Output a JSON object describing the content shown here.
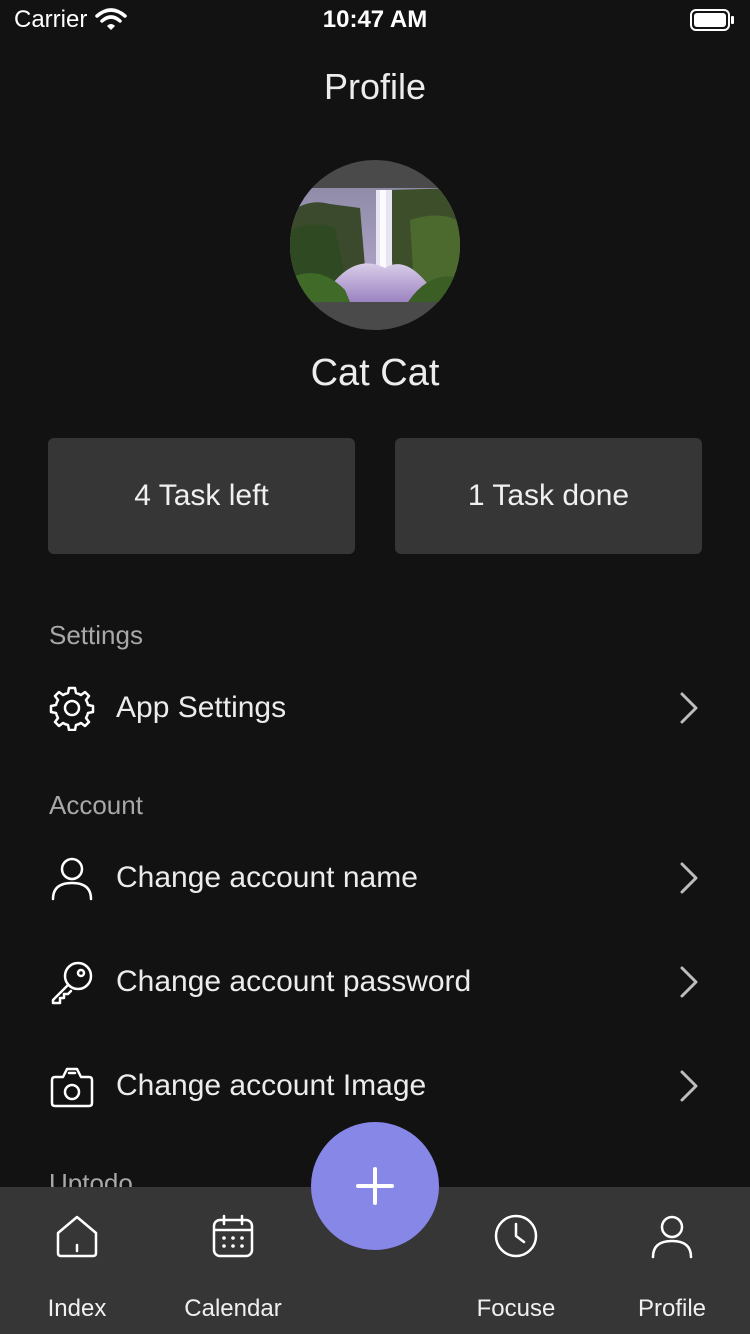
{
  "status": {
    "carrier": "Carrier",
    "time": "10:47 AM"
  },
  "header": {
    "title": "Profile"
  },
  "profile": {
    "name": "Cat Cat"
  },
  "stats": {
    "left": "4 Task left",
    "done": "1 Task done"
  },
  "sections": {
    "settings": {
      "label": "Settings",
      "items": [
        {
          "label": "App Settings",
          "icon": "gear-icon"
        }
      ]
    },
    "account": {
      "label": "Account",
      "items": [
        {
          "label": "Change account name",
          "icon": "user-icon"
        },
        {
          "label": "Change account password",
          "icon": "key-icon"
        },
        {
          "label": "Change account Image",
          "icon": "camera-icon"
        }
      ]
    },
    "uptodo": {
      "label": "Uptodo"
    }
  },
  "tabs": [
    {
      "label": "Index",
      "icon": "home-icon"
    },
    {
      "label": "Calendar",
      "icon": "calendar-icon"
    },
    {
      "label": "Focuse",
      "icon": "clock-icon"
    },
    {
      "label": "Profile",
      "icon": "user-icon"
    }
  ],
  "fab": {
    "icon": "plus-icon"
  },
  "colors": {
    "background": "#121212",
    "card": "#363636",
    "accent": "#8687e6",
    "tab_bar": "#363636"
  }
}
